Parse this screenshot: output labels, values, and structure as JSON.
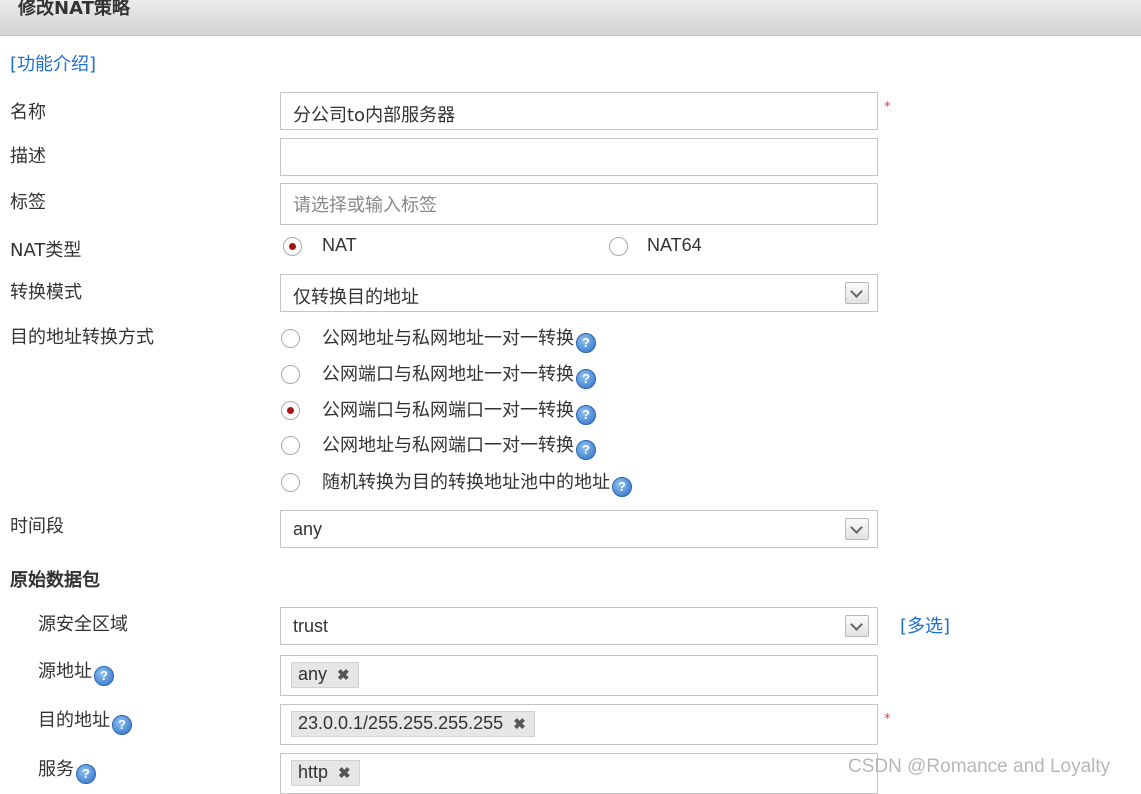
{
  "title": "修改NAT策略",
  "intro_link": "[功能介绍]",
  "labels": {
    "name": "名称",
    "description": "描述",
    "tags": "标签",
    "nat_type": "NAT类型",
    "convert_mode": "转换模式",
    "dst_convert_method": "目的地址转换方式",
    "time_range": "时间段",
    "original_packet": "原始数据包",
    "src_zone": "源安全区域",
    "src_addr": "源地址",
    "dst_addr": "目的地址",
    "service": "服务"
  },
  "fields": {
    "name_value": "分公司to内部服务器",
    "description_value": "",
    "tags_placeholder": "请选择或输入标签",
    "convert_mode_value": "仅转换目的地址",
    "time_range_value": "any",
    "src_zone_value": "trust"
  },
  "nat_type_options": [
    {
      "label": "NAT",
      "selected": true
    },
    {
      "label": "NAT64",
      "selected": false
    }
  ],
  "dst_convert_options": [
    {
      "label": "公网地址与私网地址一对一转换",
      "selected": false
    },
    {
      "label": "公网端口与私网地址一对一转换",
      "selected": false
    },
    {
      "label": "公网端口与私网端口一对一转换",
      "selected": true
    },
    {
      "label": "公网地址与私网端口一对一转换",
      "selected": false
    },
    {
      "label": "随机转换为目的转换地址池中的地址",
      "selected": false
    }
  ],
  "multi_select_link": "[多选]",
  "tags": {
    "src_addr": [
      "any"
    ],
    "dst_addr": [
      "23.0.0.1/255.255.255.255"
    ],
    "service": [
      "http"
    ]
  },
  "required_mark": "*",
  "help_glyph": "?",
  "remove_glyph": "✖",
  "watermark": "CSDN @Romance and Loyalty",
  "colors": {
    "link": "#1e6fd0",
    "radio_selected": "#a31515",
    "required": "#e23b3b",
    "help_icon": "#2c6fc4"
  }
}
